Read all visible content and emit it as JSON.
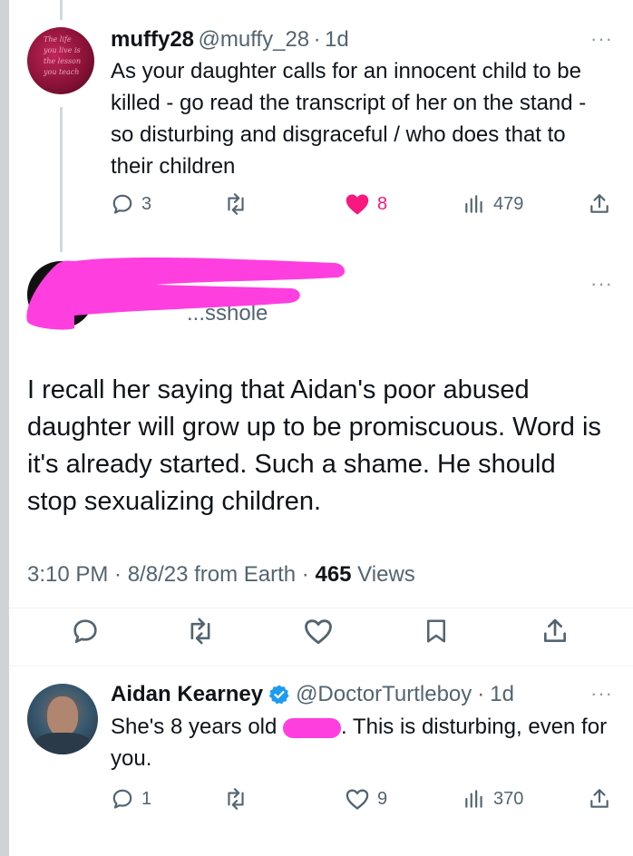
{
  "tweet1": {
    "display_name": "muffy28",
    "handle": "@muffy_28",
    "time": "1d",
    "more": "···",
    "text": "As your daughter calls for an innocent child to be killed - go read the transcript of her on the stand - so disturbing and disgraceful / who does that to their children",
    "replies": "3",
    "likes": "8",
    "views": "479",
    "avatar_text": "The life you live is the lesson you teach"
  },
  "tweet2": {
    "more": "···",
    "handle_partial": "...sshole",
    "text": "I recall her saying that Aidan's poor abused daughter will grow up to be promiscuous. Word is it's already started. Such a shame. He should stop sexualizing children.",
    "meta_time": "3:10 PM · 8/8/23 from Earth · ",
    "views_count": "465",
    "views_label": " Views"
  },
  "tweet3": {
    "display_name": "Aidan Kearney",
    "handle": "@DoctorTurtleboy",
    "time": "1d",
    "more": "···",
    "text_before": "She's 8 years old ",
    "text_after": ". This is disturbing, even for you.",
    "replies": "1",
    "likes": "9",
    "views": "370"
  },
  "colors": {
    "like_active": "#f91880",
    "verified": "#1d9bf0",
    "redaction": "#ff3ee0"
  },
  "icons": [
    "reply-icon",
    "retweet-icon",
    "heart-icon",
    "views-icon",
    "share-icon",
    "bookmark-icon",
    "verified-badge-icon"
  ]
}
